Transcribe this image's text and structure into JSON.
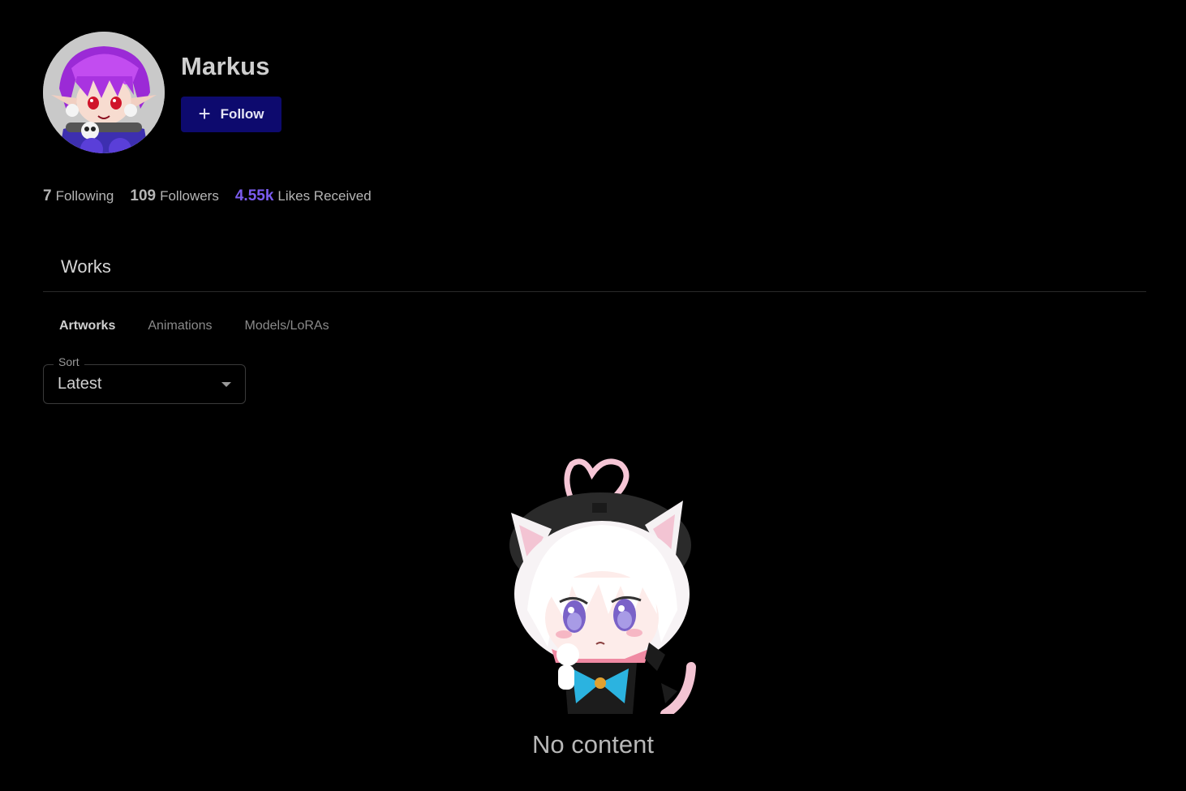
{
  "profile": {
    "username": "Markus",
    "follow_label": "Follow",
    "follow_icon": "plus-icon",
    "avatar_icon": "avatar-image"
  },
  "stats": {
    "following": {
      "count": "7",
      "label": "Following"
    },
    "followers": {
      "count": "109",
      "label": "Followers"
    },
    "likes": {
      "count": "4.55k",
      "label": "Likes Received"
    }
  },
  "works": {
    "title": "Works",
    "tabs": [
      {
        "label": "Artworks",
        "active": true
      },
      {
        "label": "Animations",
        "active": false
      },
      {
        "label": "Models/LoRAs",
        "active": false
      }
    ],
    "sort": {
      "label": "Sort",
      "value": "Latest",
      "icon": "caret-down-icon"
    }
  },
  "empty_state": {
    "text": "No content",
    "illustration": "cat-girl-illustration"
  },
  "colors": {
    "background": "#000000",
    "follow_button": "#0d0a6e",
    "likes_accent": "#7b5cf0"
  }
}
